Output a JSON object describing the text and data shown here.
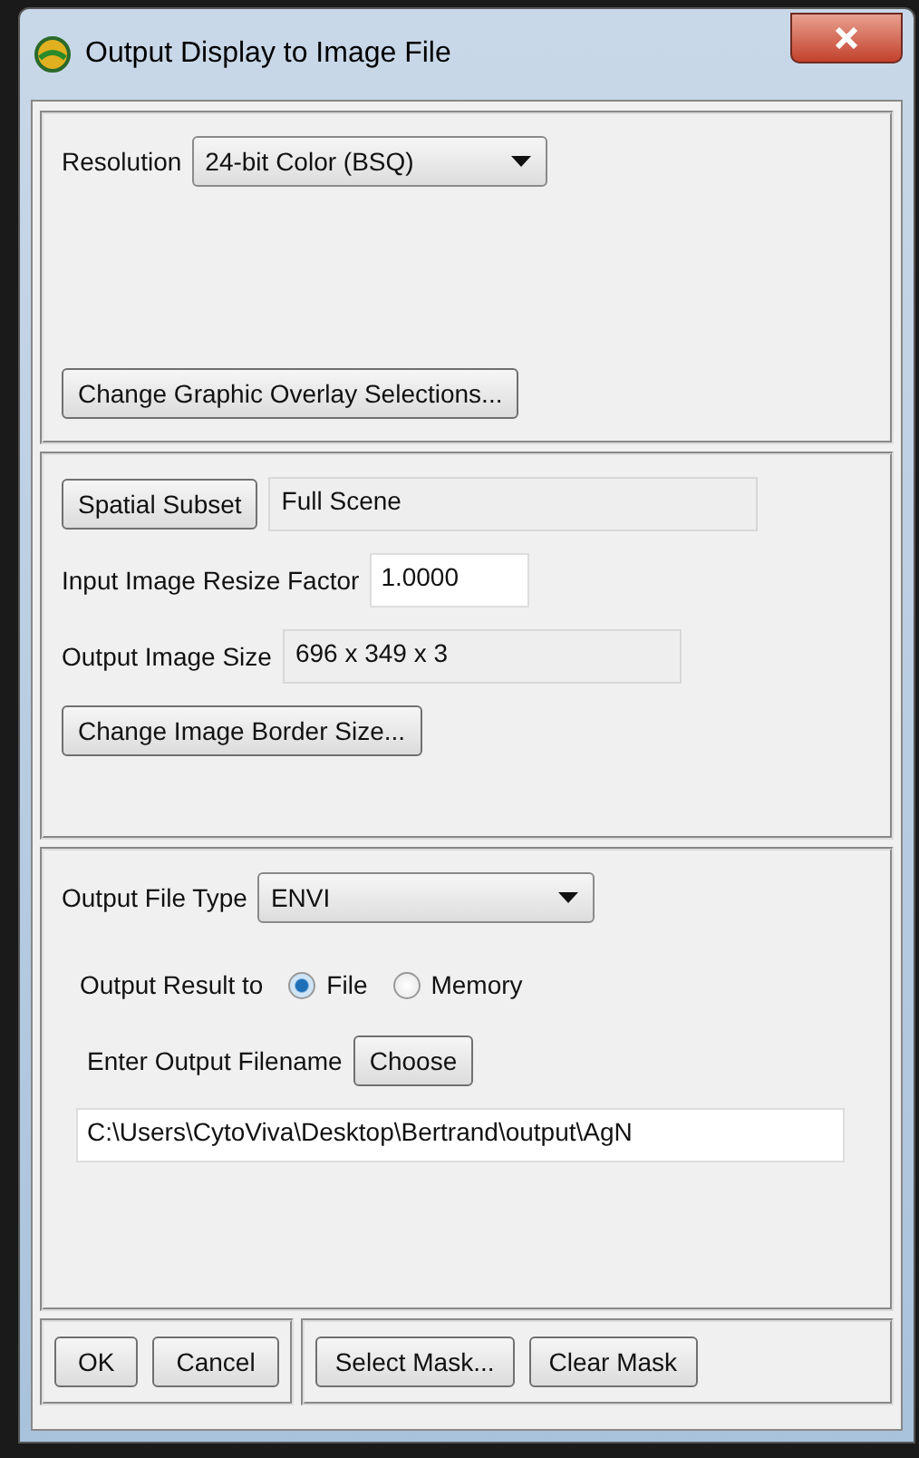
{
  "window": {
    "title": "Output Display to Image File"
  },
  "resolution": {
    "label": "Resolution",
    "value": "24-bit Color (BSQ)"
  },
  "overlay_button": "Change Graphic Overlay Selections...",
  "spatial_subset": {
    "button": "Spatial Subset",
    "value": "Full Scene"
  },
  "resize_factor": {
    "label": "Input Image Resize Factor",
    "value": "1.0000"
  },
  "output_size": {
    "label": "Output Image Size",
    "value": "696 x 349 x 3"
  },
  "border_button": "Change Image Border Size...",
  "file_type": {
    "label": "Output File Type",
    "value": "ENVI"
  },
  "output_result": {
    "label": "Output Result to",
    "options": [
      {
        "label": "File",
        "selected": true
      },
      {
        "label": "Memory",
        "selected": false
      }
    ]
  },
  "filename": {
    "label": "Enter Output Filename",
    "button": "Choose",
    "value": "C:\\Users\\CytoViva\\Desktop\\Bertrand\\output\\AgN"
  },
  "buttons_left": [
    "OK",
    "Cancel"
  ],
  "buttons_right": [
    "Select Mask...",
    "Clear Mask"
  ]
}
